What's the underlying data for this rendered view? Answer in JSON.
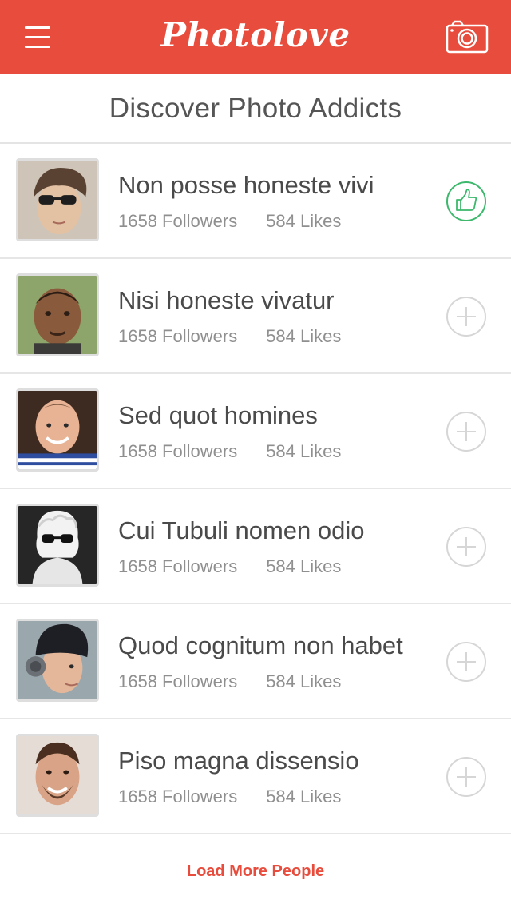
{
  "header": {
    "brand": "Photolove",
    "menu_icon": "hamburger-menu-icon",
    "camera_icon": "camera-icon",
    "color": "#e74c3c"
  },
  "section": {
    "title": "Discover Photo Addicts"
  },
  "people": [
    {
      "name": "Non posse honeste vivi",
      "followers": "1658 Followers",
      "likes": "584 Likes",
      "action_icon": "thumbs-up-icon",
      "followed": true
    },
    {
      "name": "Nisi honeste vivatur",
      "followers": "1658 Followers",
      "likes": "584 Likes",
      "action_icon": "plus-icon",
      "followed": false
    },
    {
      "name": "Sed quot homines",
      "followers": "1658 Followers",
      "likes": "584 Likes",
      "action_icon": "plus-icon",
      "followed": false
    },
    {
      "name": "Cui Tubuli nomen odio",
      "followers": "1658 Followers",
      "likes": "584 Likes",
      "action_icon": "plus-icon",
      "followed": false
    },
    {
      "name": "Quod cognitum non habet",
      "followers": "1658 Followers",
      "likes": "584 Likes",
      "action_icon": "plus-icon",
      "followed": false
    },
    {
      "name": "Piso magna dissensio",
      "followers": "1658 Followers",
      "likes": "584 Likes",
      "action_icon": "plus-icon",
      "followed": false
    }
  ],
  "footer": {
    "load_more_label": "Load More People"
  },
  "colors": {
    "accent": "#e74c3c",
    "followed": "#3db86c",
    "inactive_icon": "#d6d6d6"
  }
}
